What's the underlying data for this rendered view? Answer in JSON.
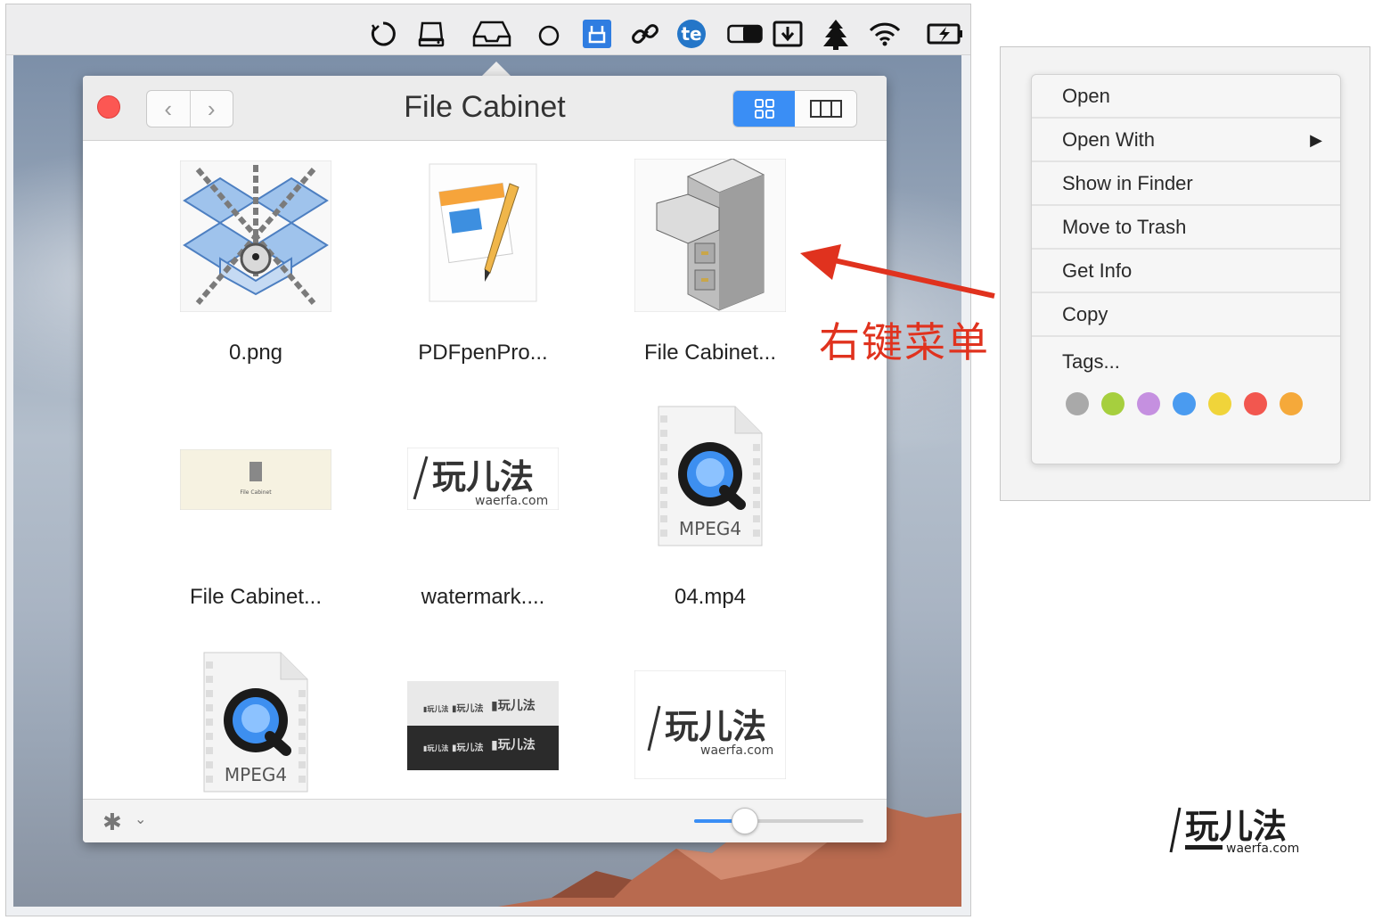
{
  "popover": {
    "title": "File Cabinet",
    "nav_back": "‹",
    "nav_forward": "›"
  },
  "files": [
    {
      "name": "0.png",
      "icon": "dropbox-chained-icon"
    },
    {
      "name": "PDFpenPro...",
      "icon": "pages-document-icon"
    },
    {
      "name": "File Cabinet...",
      "icon": "file-cabinet-icon"
    },
    {
      "name": "File Cabinet...",
      "icon": "file-cabinet-banner-icon",
      "thumb_text": "File Cabinet"
    },
    {
      "name": "watermark....",
      "icon": "waerfa-watermark-icon",
      "thumb_text": "玩儿法",
      "thumb_sub": "waerfa.com"
    },
    {
      "name": "04.mp4",
      "icon": "quicktime-mpeg4-icon",
      "thumb_text": "MPEG4"
    },
    {
      "name": "",
      "icon": "quicktime-mpeg4-icon",
      "thumb_text": "MPEG4"
    },
    {
      "name": "",
      "icon": "waerfa-banner-dark-icon"
    },
    {
      "name": "",
      "icon": "waerfa-logo-icon",
      "thumb_text": "玩儿法",
      "thumb_sub": "waerfa.com"
    }
  ],
  "zoom_level": 0.3,
  "annotation": "右键菜单",
  "context_menu": {
    "items": [
      "Open",
      "Open With",
      "Show in Finder",
      "Move to Trash",
      "Get Info",
      "Copy",
      "Tags..."
    ],
    "submenu_arrow": "▶",
    "tag_colors": [
      "#a9a9a9",
      "#a6cf3e",
      "#c590e0",
      "#4a9bf0",
      "#f0d43a",
      "#f2574f",
      "#f5a93a"
    ]
  },
  "watermark": {
    "text": "玩儿法",
    "sub": "waerfa.com"
  },
  "menubar_icons": [
    "loop-icon",
    "drive-icon",
    "inbox-tray-icon",
    "circle-icon",
    "app-blue-icon",
    "link-icon",
    "te-icon",
    "toggle-icon",
    "download-icon",
    "tree-icon",
    "wifi-icon",
    "battery-charging-icon"
  ]
}
